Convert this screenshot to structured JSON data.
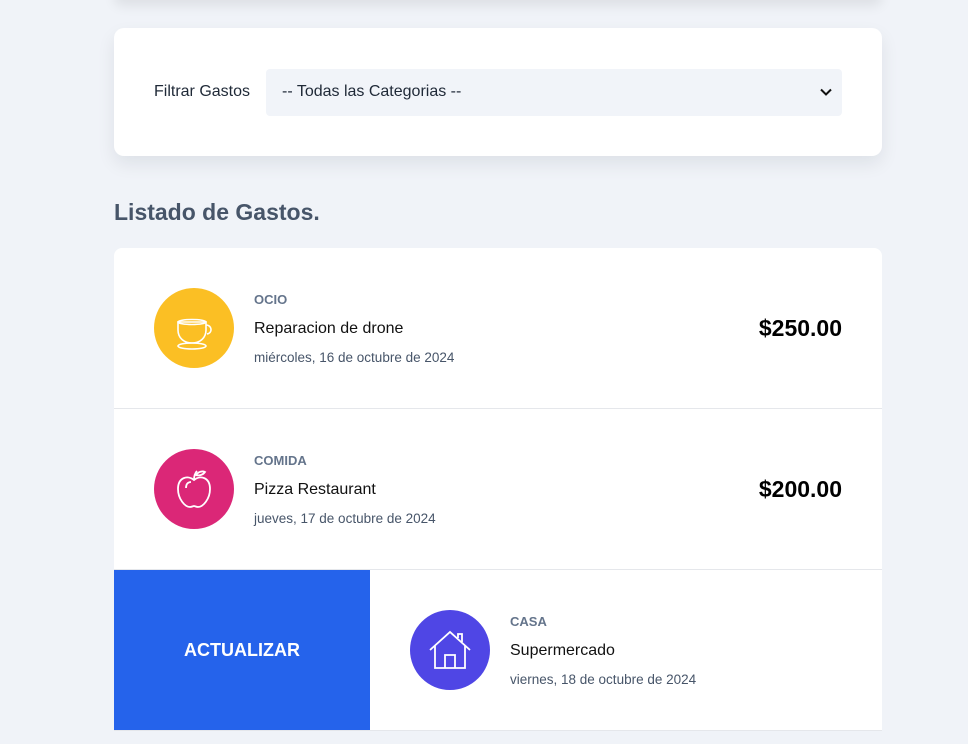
{
  "filter": {
    "label": "Filtrar Gastos",
    "selected": "-- Todas las Categorias --"
  },
  "list_title": "Listado de Gastos.",
  "expenses": [
    {
      "category": "OCIO",
      "name": "Reparacion de drone",
      "date": "miércoles, 16 de octubre de 2024",
      "amount": "$250.00",
      "icon": "cup-icon",
      "color": "#fbbf24"
    },
    {
      "category": "COMIDA",
      "name": "Pizza Restaurant",
      "date": "jueves, 17 de octubre de 2024",
      "amount": "$200.00",
      "icon": "apple-icon",
      "color": "#db2777"
    },
    {
      "category": "CASA",
      "name": "Supermercado",
      "date": "viernes, 18 de octubre de 2024",
      "icon": "house-icon",
      "color": "#4f46e5"
    }
  ],
  "action": {
    "update_label": "ACTUALIZAR",
    "color": "#2563eb"
  }
}
